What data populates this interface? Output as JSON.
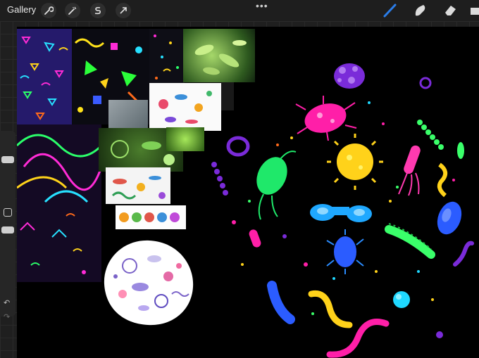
{
  "toolbar": {
    "gallery_label": "Gallery",
    "left_tools": [
      "wrench-icon",
      "magic-wand-icon",
      "selection-icon",
      "transform-arrow-icon"
    ],
    "menu_dots": "•••",
    "right_tools": [
      "brush-icon",
      "smudge-icon",
      "eraser-icon",
      "layers-icon"
    ],
    "active_color": "#1a72e8"
  },
  "sidebar": {
    "undo_glyph": "↶",
    "redo_glyph": "↷"
  },
  "colors": {
    "toolbar_bg": "#1e1e1e",
    "canvas_bg": "#000000",
    "accent": "#2b7de9"
  },
  "canvas": {
    "images": [
      "neon-triangle-pattern",
      "neon-confetti-pattern",
      "small-confetti-pattern",
      "green-bacteria-photo",
      "purple-squiggle-pattern",
      "microscope-photo",
      "white-bacteria-sticker",
      "green-microbes-photo",
      "green-cell-photo",
      "color-bacteria-strip",
      "color-bacteria-dots",
      "bacteria-circle-sticker",
      "neon-germs-illustration"
    ]
  }
}
